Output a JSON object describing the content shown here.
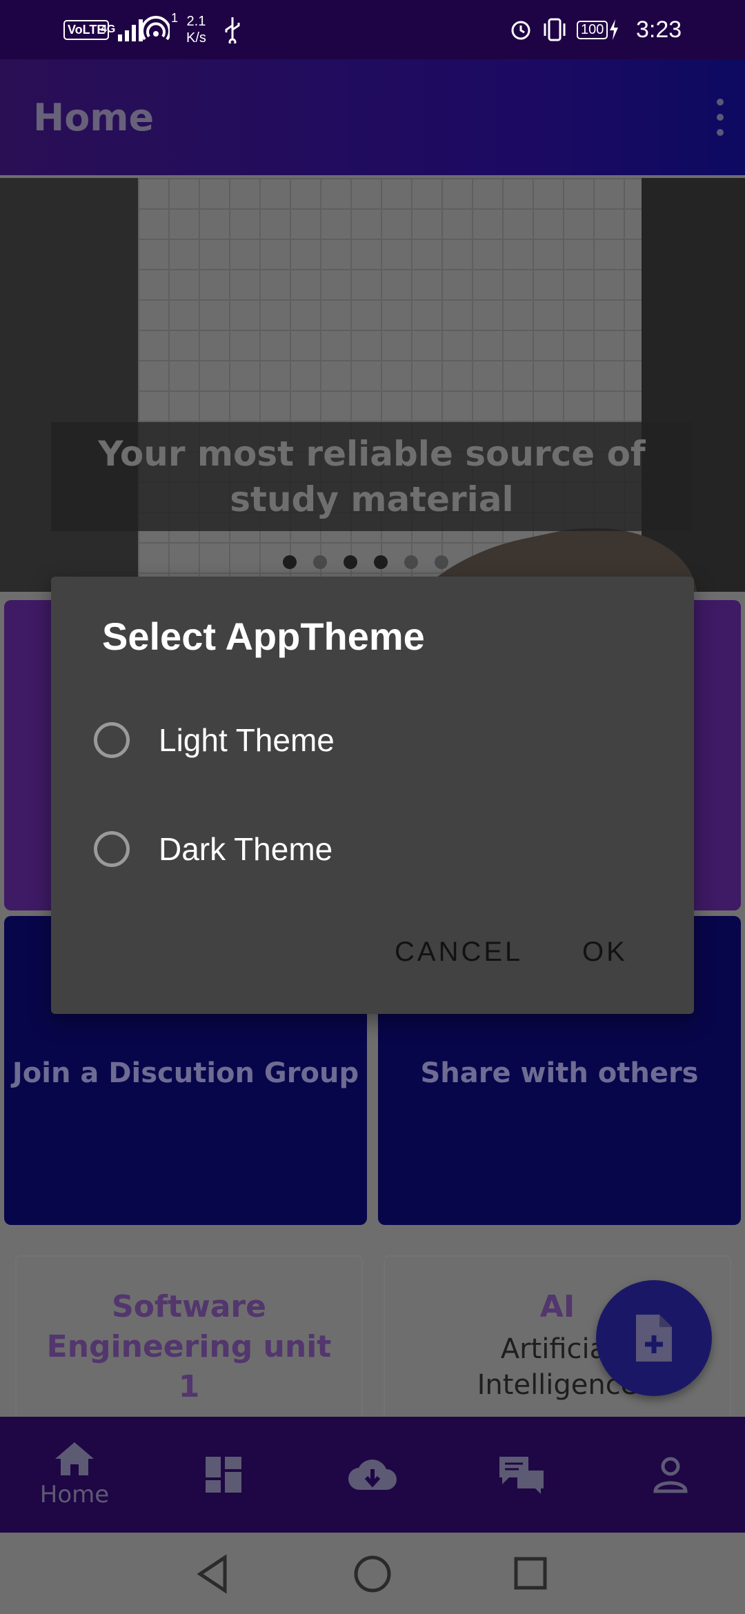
{
  "status_bar": {
    "volte": "VoLTE",
    "network": "4G",
    "hotspot_count": "1",
    "speed_value": "2.1",
    "speed_unit": "K/s",
    "battery": "100",
    "time": "3:23"
  },
  "app_bar": {
    "title": "Home"
  },
  "banner": {
    "caption": "Your most reliable source of study material",
    "dots_total": 6,
    "active_dot": 0
  },
  "cards": [
    {
      "label": "Join a Discution Group"
    },
    {
      "label": "Share with others"
    }
  ],
  "bottom_cards": [
    {
      "title": "Software Engineering unit 1",
      "subtitle": ""
    },
    {
      "title": "AI",
      "subtitle": "Artificial Intelligence"
    }
  ],
  "bottom_nav": {
    "home_label": "Home"
  },
  "dialog": {
    "title": "Select AppTheme",
    "options": [
      "Light Theme",
      "Dark Theme"
    ],
    "cancel_label": "CANCEL",
    "ok_label": "OK"
  },
  "icons": {
    "fab": "add-document-icon",
    "nav": [
      "home-icon",
      "dashboard-icon",
      "cloud-download-icon",
      "chat-icon",
      "account-icon"
    ]
  }
}
